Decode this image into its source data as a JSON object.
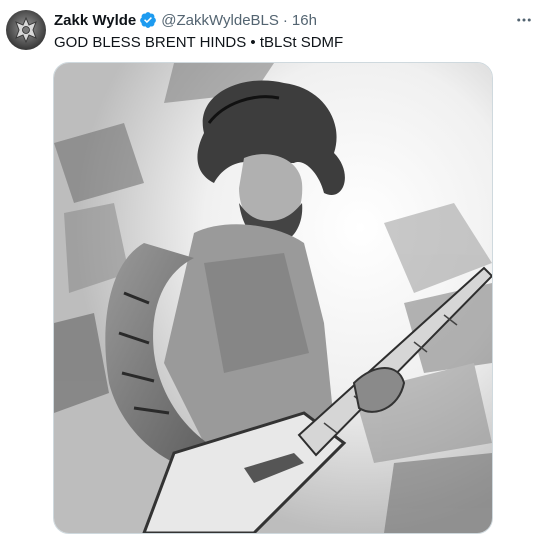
{
  "post": {
    "author_name": "Zakk Wylde",
    "verified_icon": "verified-badge-icon",
    "handle": "@ZakkWyldeBLS",
    "separator": "·",
    "timestamp": "16h",
    "text": "GOD BLESS BRENT HINDS • tBLSt SDMF",
    "more_icon": "more-options-icon",
    "media_icon": "guitarist-sketch-image"
  },
  "colors": {
    "verified_blue": "#1d9bf0",
    "secondary_text": "#536471",
    "border": "#cfd9de"
  }
}
